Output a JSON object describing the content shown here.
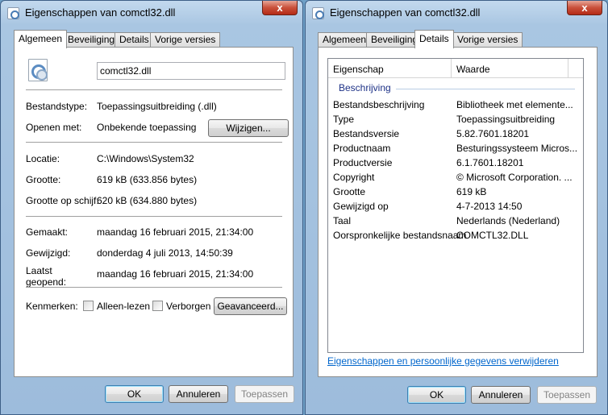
{
  "windows": [
    {
      "title": "Eigenschappen van comctl32.dll",
      "close_label": "x",
      "tabs": [
        {
          "label": "Algemeen",
          "active": true
        },
        {
          "label": "Beveiliging",
          "active": false
        },
        {
          "label": "Details",
          "active": false
        },
        {
          "label": "Vorige versies",
          "active": false
        }
      ],
      "filename": "comctl32.dll",
      "rows": {
        "bestandstype": {
          "label": "Bestandstype:",
          "value": "Toepassingsuitbreiding (.dll)"
        },
        "openen_met": {
          "label": "Openen met:",
          "value": "Onbekende toepassing"
        },
        "locatie": {
          "label": "Locatie:",
          "value": "C:\\Windows\\System32"
        },
        "grootte": {
          "label": "Grootte:",
          "value": "619 kB (633.856 bytes)"
        },
        "grootte_schijf": {
          "label": "Grootte op schijf:",
          "value": "620 kB (634.880 bytes)"
        },
        "gemaakt": {
          "label": "Gemaakt:",
          "value": "maandag 16 februari 2015, 21:34:00"
        },
        "gewijzigd": {
          "label": "Gewijzigd:",
          "value": "donderdag 4 juli 2013, 14:50:39"
        },
        "laatst_geopend": {
          "label_1": "Laatst",
          "label_2": "geopend:",
          "value": "maandag 16 februari 2015, 21:34:00"
        }
      },
      "change_button": "Wijzigen...",
      "attributes_label": "Kenmerken:",
      "readonly_label": "Alleen-lezen",
      "hidden_label": "Verborgen",
      "advanced_button": "Geavanceerd...",
      "buttons": {
        "ok": "OK",
        "cancel": "Annuleren",
        "apply": "Toepassen"
      }
    },
    {
      "title": "Eigenschappen van comctl32.dll",
      "close_label": "x",
      "tabs": [
        {
          "label": "Algemeen",
          "active": false
        },
        {
          "label": "Beveiliging",
          "active": false
        },
        {
          "label": "Details",
          "active": true
        },
        {
          "label": "Vorige versies",
          "active": false
        }
      ],
      "columns": {
        "property": "Eigenschap",
        "value": "Waarde"
      },
      "section": "Beschrijving",
      "props": [
        {
          "name": "Bestandsbeschrijving",
          "value": "Bibliotheek met elemente..."
        },
        {
          "name": "Type",
          "value": "Toepassingsuitbreiding"
        },
        {
          "name": "Bestandsversie",
          "value": "5.82.7601.18201"
        },
        {
          "name": "Productnaam",
          "value": "Besturingssysteem Micros..."
        },
        {
          "name": "Productversie",
          "value": "6.1.7601.18201"
        },
        {
          "name": "Copyright",
          "value": "© Microsoft Corporation. ..."
        },
        {
          "name": "Grootte",
          "value": "619 kB"
        },
        {
          "name": "Gewijzigd op",
          "value": "4-7-2013 14:50"
        },
        {
          "name": "Taal",
          "value": "Nederlands (Nederland)"
        },
        {
          "name": "Oorspronkelijke bestandsnaam",
          "value": "COMCTL32.DLL"
        }
      ],
      "remove_link": "Eigenschappen en persoonlijke gegevens verwijderen",
      "buttons": {
        "ok": "OK",
        "cancel": "Annuleren",
        "apply": "Toepassen"
      }
    }
  ]
}
